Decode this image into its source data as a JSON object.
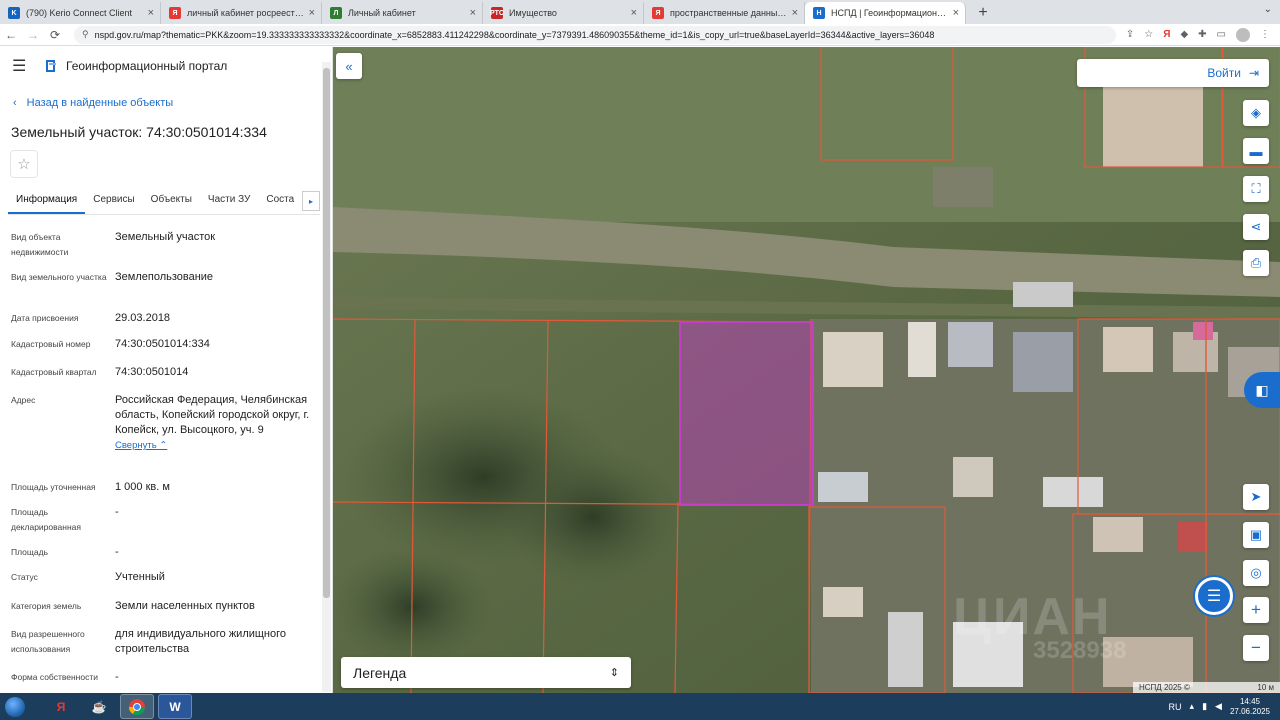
{
  "browser": {
    "tabs": [
      {
        "title": "(790) Kerio Connect Client",
        "icon_color": "#1565c0",
        "icon_text": "K"
      },
      {
        "title": "личный кабинет росреестра —",
        "icon_color": "#e53935",
        "icon_text": "Я"
      },
      {
        "title": "Личный кабинет",
        "icon_color": "#2e7d32",
        "icon_text": "Л"
      },
      {
        "title": "Имущество",
        "icon_color": "#c62828",
        "icon_text": "РТС"
      },
      {
        "title": "пространственные данные рос",
        "icon_color": "#e53935",
        "icon_text": "Я"
      },
      {
        "title": "НСПД | Геоинформационный п",
        "icon_color": "#1a6dcc",
        "icon_text": "Н"
      }
    ],
    "active_tab": 5,
    "url": "nspd.gov.ru/map?thematic=PKK&zoom=19.333333333333332&coordinate_x=6852883.411242298&coordinate_y=7379391.486090355&theme_id=1&is_copy_url=true&baseLayerId=36344&active_layers=36048"
  },
  "panel": {
    "portal_title": "Геоинформационный портал",
    "back_label": "Назад в найденные объекты",
    "object_title": "Земельный участок: 74:30:0501014:334",
    "tabs": [
      "Информация",
      "Сервисы",
      "Объекты",
      "Части ЗУ",
      "Соста"
    ],
    "active_tab": 0,
    "attributes": [
      {
        "label": "Вид объекта недвижимости",
        "value": "Земельный участок"
      },
      {
        "label": "Вид земельного участка",
        "value": "Землепользование"
      },
      {
        "label": "Дата присвоения",
        "value": "29.03.2018"
      },
      {
        "label": "Кадастровый номер",
        "value": "74:30:0501014:334"
      },
      {
        "label": "Кадастровый квартал",
        "value": "74:30:0501014"
      },
      {
        "label": "Адрес",
        "value": "Российская Федерация, Челябинская область, Копейский городской округ, г. Копейск, ул. Высоцкого, уч. 9"
      },
      {
        "label": "Площадь уточненная",
        "value": "1 000 кв. м"
      },
      {
        "label": "Площадь декларированная",
        "value": "-"
      },
      {
        "label": "Площадь",
        "value": "-"
      },
      {
        "label": "Статус",
        "value": "Учтенный"
      },
      {
        "label": "Категория земель",
        "value": "Земли населенных пунктов"
      },
      {
        "label": "Вид разрешенного использования",
        "value": "для индивидуального жилищного строительства"
      },
      {
        "label": "Форма собственности",
        "value": "-"
      }
    ],
    "collapse_label": "Свернуть"
  },
  "map": {
    "login_label": "Войти",
    "legend_label": "Легенда",
    "scale_label": "10 м",
    "copyright": "НСПД 2025 ©",
    "watermark": "ЦИАН",
    "watermark_id": "3528938",
    "highlight_color": "#c93ccf",
    "boundary_color": "#e05a3a"
  },
  "taskbar": {
    "lang": "RU",
    "time": "14:45",
    "date": "27.06.2025"
  }
}
